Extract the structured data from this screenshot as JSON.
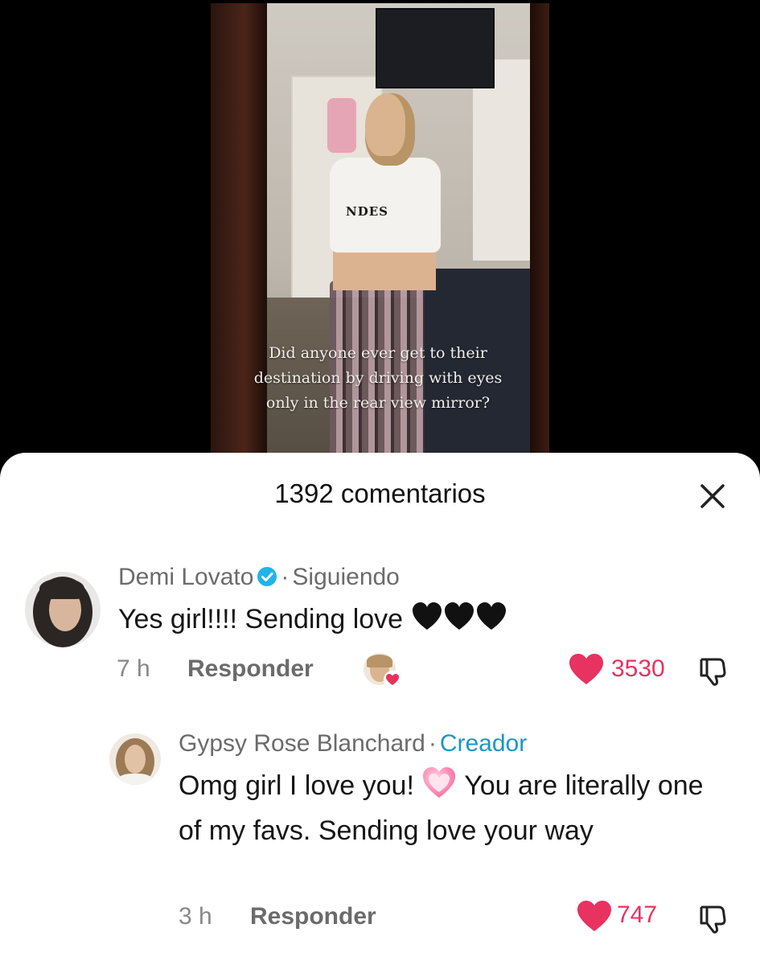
{
  "video": {
    "overlay_caption": "Did anyone ever get to their destination by driving with eyes only in the rear view mirror?",
    "shirt_text": "NDES"
  },
  "sheet": {
    "title": "1392 comentarios",
    "close_icon": "close-icon"
  },
  "comments": [
    {
      "author": "Demi Lovato",
      "verified": true,
      "separator": "·",
      "relation": "Siguiendo",
      "text": "Yes girl!!!! Sending love",
      "emoji": "black-heart x3",
      "time": "7 h",
      "reply_label": "Responder",
      "likes": "3530",
      "liked_by_creator": true
    },
    {
      "author": "Gypsy Rose Blanchard",
      "separator": "·",
      "relation": "Creador",
      "text_part1": "Omg girl I love you!",
      "text_part2": "You are literally one of my favs. Sending love your way",
      "emoji": "pink-heart",
      "time": "3 h",
      "reply_label": "Responder",
      "likes": "747"
    }
  ],
  "colors": {
    "like": "#e8325f",
    "creator_label": "#1d96c2",
    "verified": "#20b4ea"
  }
}
